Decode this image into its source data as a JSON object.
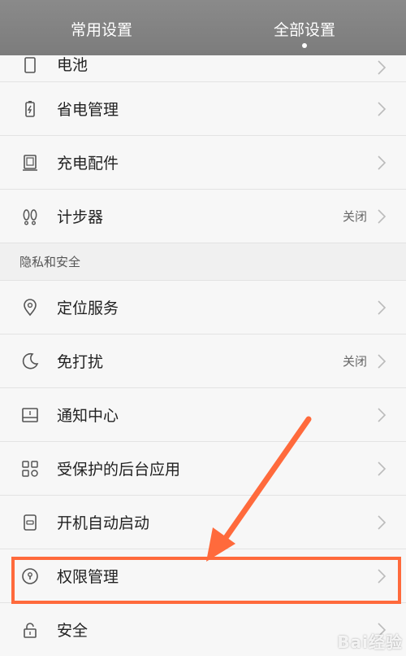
{
  "header": {
    "tabs": [
      {
        "label": "常用设置"
      },
      {
        "label": "全部设置"
      }
    ]
  },
  "rows": {
    "battery": {
      "label": "电池",
      "icon": "battery-icon"
    },
    "power_saving": {
      "label": "省电管理",
      "icon": "power-saving-icon"
    },
    "charging_accessory": {
      "label": "充电配件",
      "icon": "charger-icon"
    },
    "pedometer": {
      "label": "计步器",
      "value": "关闭",
      "icon": "footprints-icon"
    }
  },
  "section_privacy": {
    "title": "隐私和安全"
  },
  "privacy_rows": {
    "location": {
      "label": "定位服务",
      "icon": "location-pin-icon"
    },
    "dnd": {
      "label": "免打扰",
      "value": "关闭",
      "icon": "moon-icon"
    },
    "notifications": {
      "label": "通知中心",
      "icon": "notification-icon"
    },
    "protected_apps": {
      "label": "受保护的后台应用",
      "icon": "apps-grid-icon"
    },
    "autostart": {
      "label": "开机自动启动",
      "icon": "power-toggle-icon"
    },
    "permissions": {
      "label": "权限管理",
      "icon": "keyhole-icon"
    },
    "security": {
      "label": "安全",
      "icon": "lock-icon"
    }
  },
  "annotation": {
    "highlight_color": "#ff6a3c"
  },
  "watermark": {
    "text": "Bai经验"
  }
}
